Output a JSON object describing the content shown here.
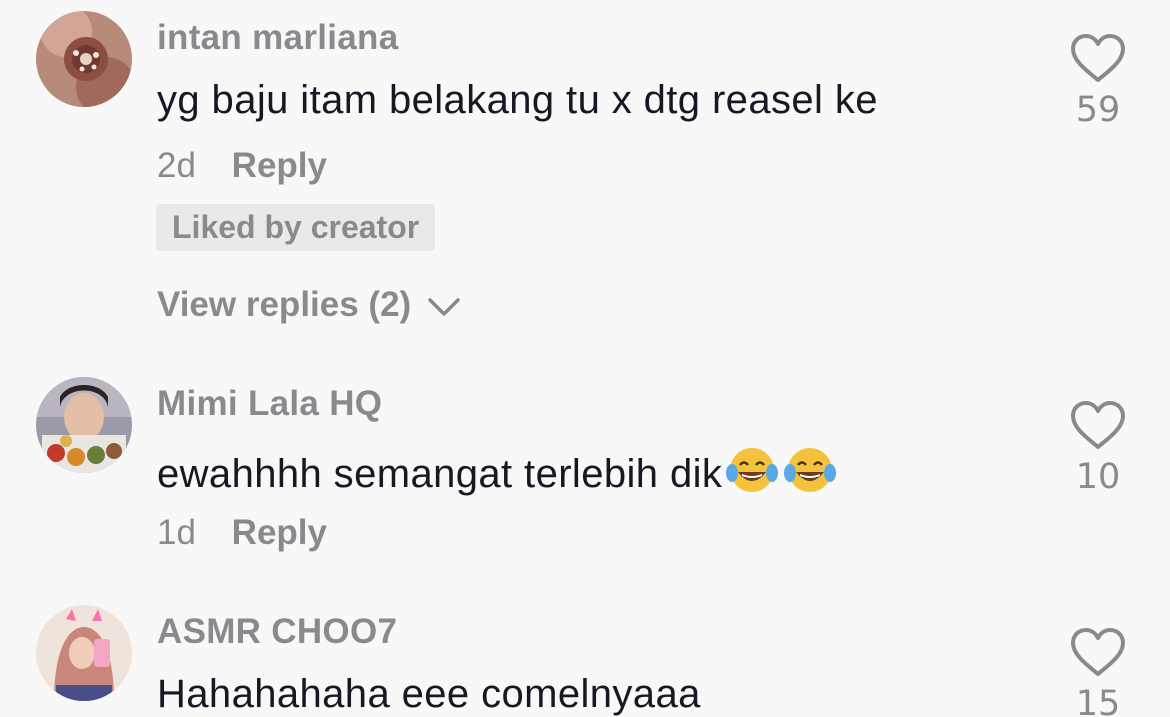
{
  "comments": [
    {
      "username": "intan marliana",
      "text": "yg baju itam belakang tu x dtg reasel ke",
      "time": "2d",
      "reply_label": "Reply",
      "liked_by_creator": "Liked by creator",
      "view_replies": "View replies (2)",
      "likes": "59",
      "avatar": "flower-bouquet-avatar"
    },
    {
      "username": "Mimi Lala HQ",
      "text": "ewahhhh semangat terlebih dik",
      "emoji": "tears-of-joy-emoji",
      "time": "1d",
      "reply_label": "Reply",
      "likes": "10",
      "avatar": "woman-with-spices-avatar"
    },
    {
      "username": "ASMR CHOO7",
      "text": "Hahahahaha eee comelnyaaa",
      "likes": "15",
      "avatar": "hijab-selfie-avatar"
    }
  ],
  "colors": {
    "background": "#f8f8f8",
    "primary_text": "#161823",
    "secondary_text": "#8a8a8e",
    "badge_bg": "#e9e9ea"
  }
}
